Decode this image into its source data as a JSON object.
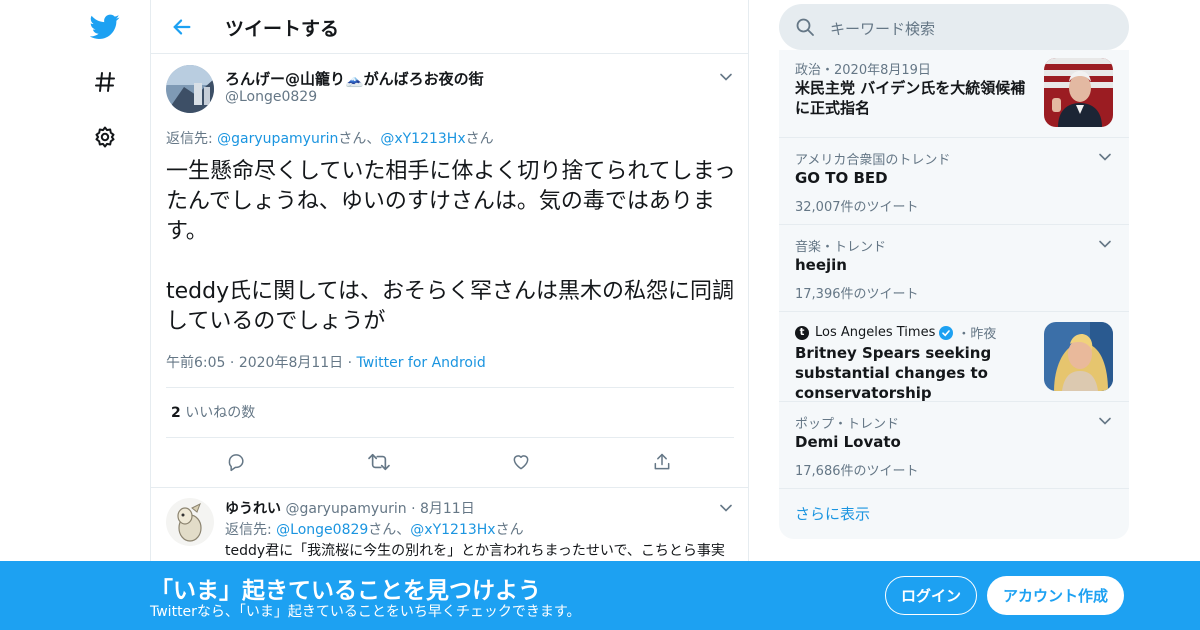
{
  "nav": {
    "logo_icon": "twitter-bird-icon",
    "explore_icon": "hashtag-icon",
    "settings_icon": "gear-icon"
  },
  "header": {
    "title": "ツイートする"
  },
  "tweet": {
    "author_name": "ろんげー@山籠り🗻がんばろお夜の街",
    "author_handle": "@Longe0829",
    "reply_to_prefix": "返信先: ",
    "reply_to_user1": "@garyupamyurin",
    "reply_to_mid": "さん、",
    "reply_to_user2": "@xY1213Hx",
    "reply_to_suffix": "さん",
    "text": "一生懸命尽くしていた相手に体よく切り捨てられてしまったんでしょうね、ゆいのすけさんは。気の毒ではあります。\n\nteddy氏に関しては、おそらく罕さんは黒木の私怨に同調しているのでしょうが",
    "time": "午前6:05",
    "date": "2020年8月11日",
    "dot": "·",
    "source": "Twitter for Android",
    "likes_count": "2",
    "likes_label": "いいねの数"
  },
  "reply": {
    "name": "ゆうれい",
    "handle": "@garyupamyurin",
    "date": "8月11日",
    "dot": "·",
    "reply_to_prefix": "返信先: ",
    "reply_to_user1": "@Longe0829",
    "reply_to_mid": "さん、",
    "reply_to_user2": "@xY1213Hx",
    "reply_to_suffix": "さん",
    "text": "teddy君に「我流桜に今生の別れを」とか言われちまったせいで、こちとら事実"
  },
  "search": {
    "placeholder": "キーワード検索"
  },
  "trends": [
    {
      "context": "政治・2020年8月19日",
      "title": "米民主党 バイデン氏を大統領候補に正式指名",
      "count": ""
    },
    {
      "context": "アメリカ合衆国のトレンド",
      "title": "GO TO BED",
      "count": "32,007件のツイート"
    },
    {
      "context": "音楽・トレンド",
      "title": "heejin",
      "count": "17,396件のツイート"
    },
    {
      "context_source": "Los Angeles Times",
      "context_suffix": "・昨夜",
      "title": "Britney Spears seeking substantial changes to conservatorship",
      "count": ""
    },
    {
      "context": "ポップ・トレンド",
      "title": "Demi Lovato",
      "count": "17,686件のツイート"
    }
  ],
  "show_more": "さらに表示",
  "banner": {
    "title": "「いま」起きていることを見つけよう",
    "subtitle": "Twitterなら、「いま」起きていることをいち早くチェックできます。",
    "login": "ログイン",
    "signup": "アカウント作成"
  },
  "colors": {
    "accent": "#1da1f2",
    "link": "#1b95e0",
    "muted": "#657786",
    "border": "#e6ecf0"
  }
}
